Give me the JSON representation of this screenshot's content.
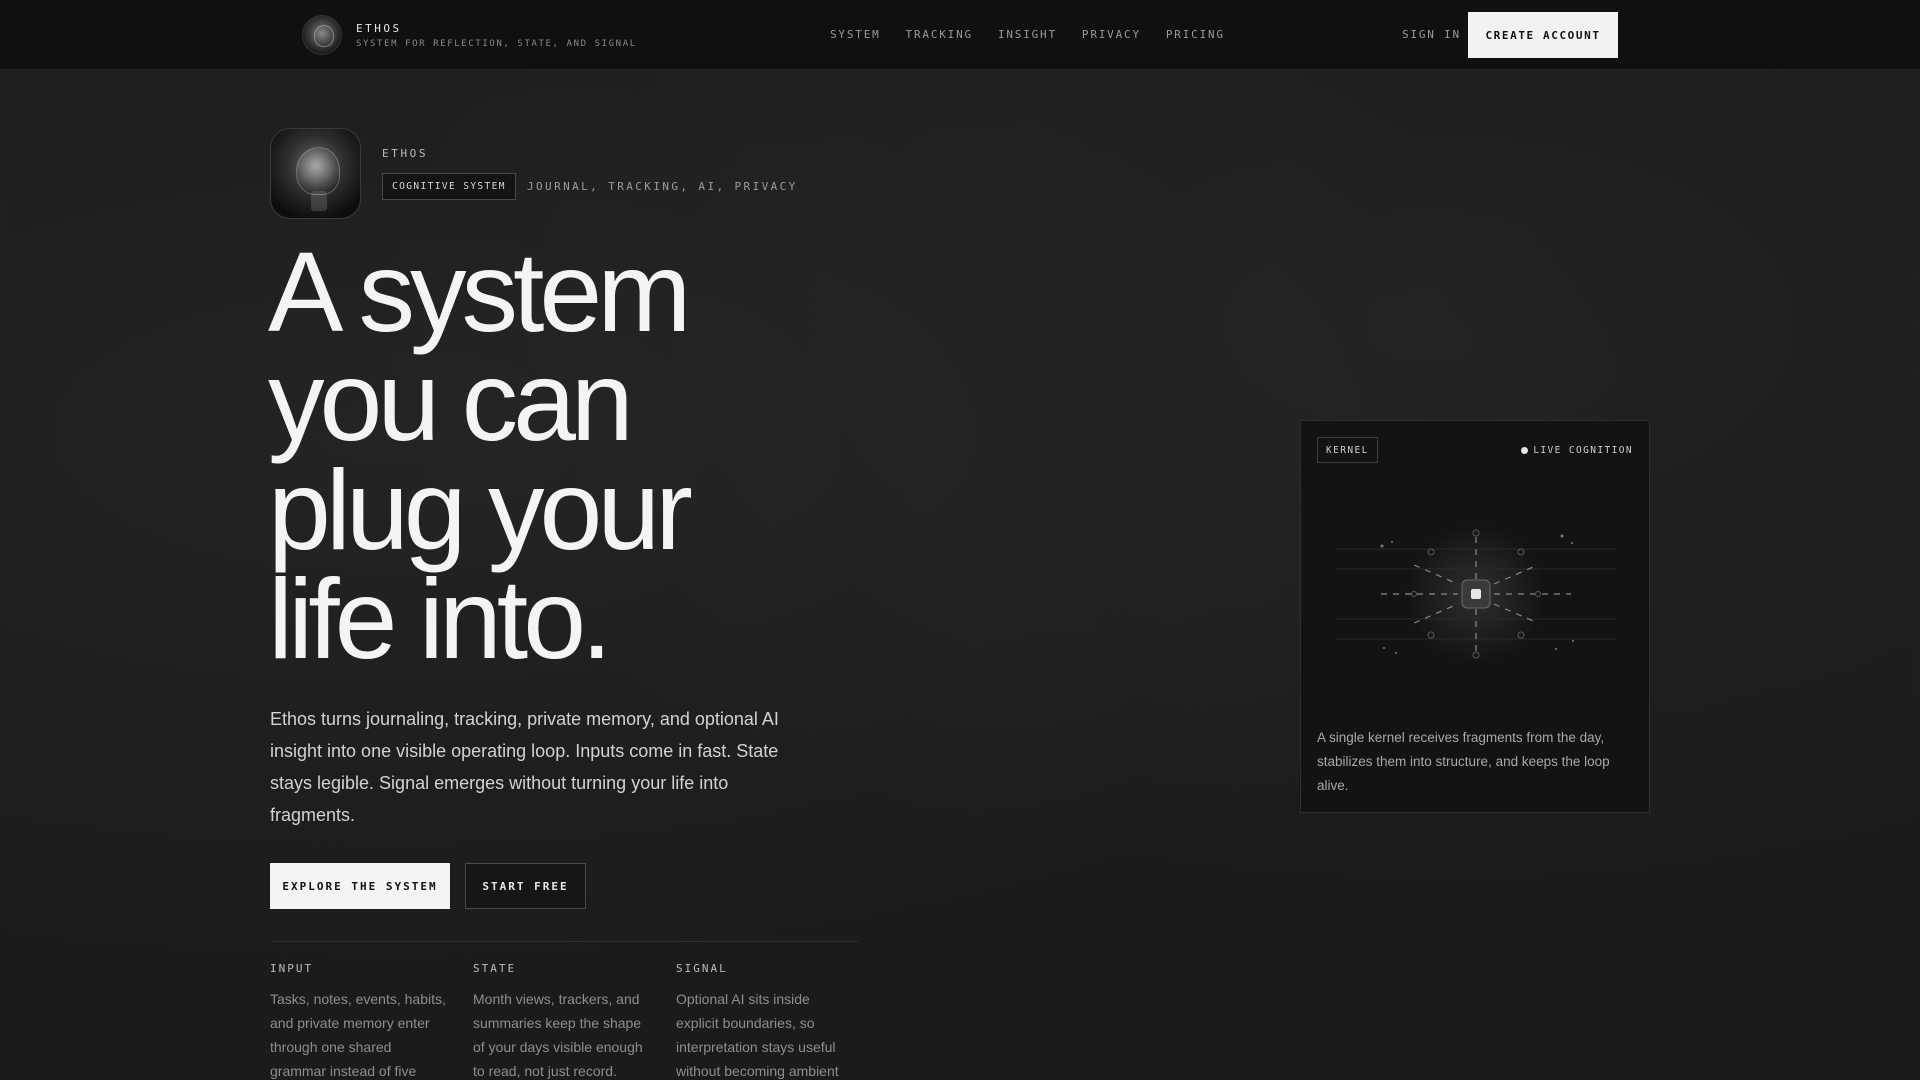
{
  "nav": {
    "brand_name": "ETHOS",
    "brand_tagline": "SYSTEM FOR REFLECTION, STATE, AND SIGNAL",
    "links": [
      "SYSTEM",
      "TRACKING",
      "INSIGHT",
      "PRIVACY",
      "PRICING"
    ],
    "sign_in": "SIGN IN",
    "create_account": "CREATE ACCOUNT"
  },
  "hero": {
    "eyebrow": "ETHOS",
    "chip": "COGNITIVE SYSTEM",
    "tags": "JOURNAL, TRACKING, AI, PRIVACY",
    "headline_lines": [
      "A system",
      "you can",
      "plug your",
      "life into."
    ],
    "lede": "Ethos turns journaling, tracking, private memory, and optional AI insight into one visible operating loop. Inputs come in fast. State stays legible. Signal emerges without turning your life into fragments.",
    "primary_cta": "EXPLORE THE SYSTEM",
    "secondary_cta": "START FREE"
  },
  "features": [
    {
      "title": "INPUT",
      "body": "Tasks, notes, events, habits, and private memory enter through one shared grammar instead of five"
    },
    {
      "title": "STATE",
      "body": "Month views, trackers, and summaries keep the shape of your days visible enough to read, not just record."
    },
    {
      "title": "SIGNAL",
      "body": "Optional AI sits inside explicit boundaries, so interpretation stays useful without becoming ambient"
    }
  ],
  "kernel_card": {
    "badge": "KERNEL",
    "status": "LIVE COGNITION",
    "description": "A single kernel receives fragments from the day, stabilizes them into structure, and keeps the loop alive."
  },
  "colors": {
    "background": "#1b1b1b",
    "nav_background": "#101010",
    "primary_button": "#f4f4f4",
    "text": "#f4f4f4"
  }
}
